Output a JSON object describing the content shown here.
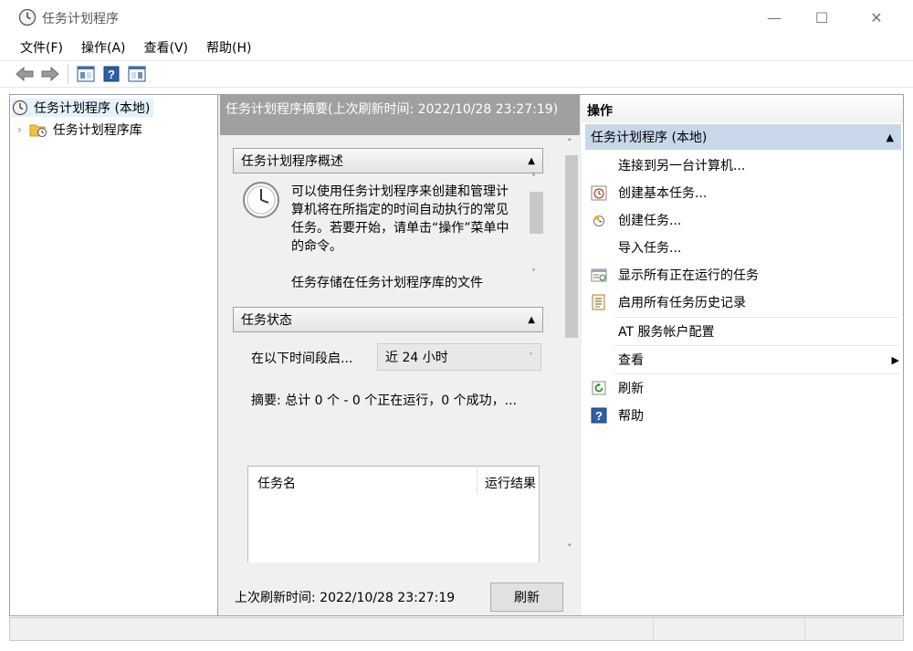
{
  "window": {
    "title": "任务计划程序",
    "minimize": "—",
    "maximize": "☐",
    "close": "✕"
  },
  "menu": [
    "文件(F)",
    "操作(A)",
    "查看(V)",
    "帮助(H)"
  ],
  "tree": {
    "root_label": "任务计划程序 (本地)",
    "child_label": "任务计划程序库"
  },
  "center": {
    "header": "任务计划程序摘要(上次刷新时间: 2022/10/28 23:27:19)",
    "overview": {
      "title": "任务计划程序概述",
      "text": "可以使用任务计划程序来创建和管理计算机将在所指定的时间自动执行的常见任务。若要开始，请单击“操作”菜单中的命令。",
      "text2": "任务存储在任务计划程序库的文件"
    },
    "status": {
      "title": "任务状态",
      "period_label": "在以下时间段启...",
      "period_value": "近 24 小时",
      "summary": "摘要: 总计 0 个 - 0 个正在运行，0 个成功，...",
      "columns": [
        "任务名",
        "运行结果"
      ]
    },
    "last_refresh": "上次刷新时间: 2022/10/28 23:27:19",
    "refresh_button": "刷新"
  },
  "actions": {
    "header": "操作",
    "group": "任务计划程序 (本地)",
    "items": [
      {
        "label": "连接到另一台计算机...",
        "icon": "none"
      },
      {
        "label": "创建基本任务...",
        "icon": "basic-task-icon"
      },
      {
        "label": "创建任务...",
        "icon": "create-task-icon"
      },
      {
        "label": "导入任务...",
        "icon": "none"
      },
      {
        "label": "显示所有正在运行的任务",
        "icon": "running-tasks-icon"
      },
      {
        "label": "启用所有任务历史记录",
        "icon": "history-icon"
      },
      {
        "label": "AT 服务帐户配置",
        "icon": "none"
      },
      {
        "label": "查看",
        "icon": "none"
      },
      {
        "label": "刷新",
        "icon": "refresh-icon"
      },
      {
        "label": "帮助",
        "icon": "help-icon"
      }
    ]
  },
  "colors": {
    "selection": "#c8d8ea",
    "header_gray": "#a0a0a0",
    "help_blue": "#2d5fa8"
  }
}
